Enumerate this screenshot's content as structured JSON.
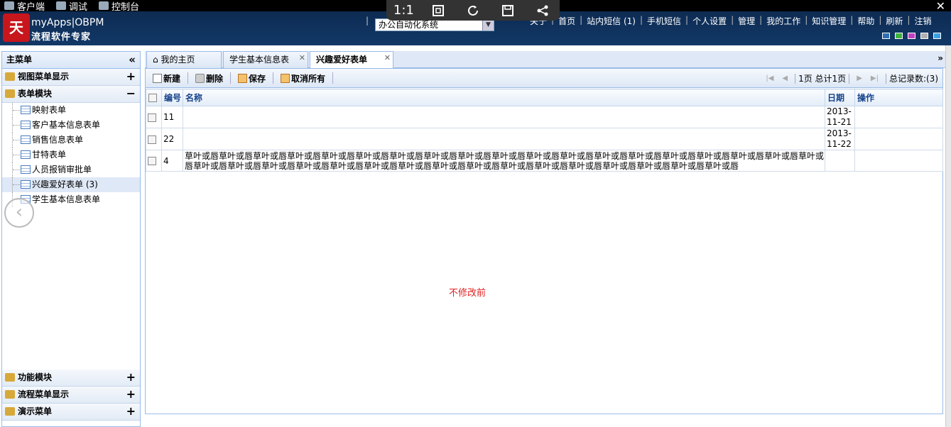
{
  "topbar": {
    "items": [
      {
        "label": "客户端",
        "icon": "gear-icon"
      },
      {
        "label": "调试",
        "icon": "gear-icon"
      },
      {
        "label": "控制台",
        "icon": "console-icon"
      }
    ],
    "close": "✕"
  },
  "viewer": {
    "zoom_label": "1:1",
    "buttons": [
      "fit-icon",
      "rotate-icon",
      "save-icon",
      "share-icon"
    ]
  },
  "header": {
    "logo_text": "天翎",
    "brand_line1": "myApps|OBPM",
    "brand_line2": "流程软件专家",
    "system_select": "办公自动化系统",
    "nav": [
      "关于",
      "首页",
      "站内短信 (1)",
      "手机短信",
      "个人设置",
      "管理",
      "我的工作",
      "知识管理",
      "帮助",
      "刷新",
      "注销"
    ],
    "swatch_colors": [
      "#2f6fb0",
      "#3cb43c",
      "#c040c0",
      "#b0b0b0",
      "#3aa0e0"
    ]
  },
  "sidebar": {
    "title": "主菜单",
    "collapse_icon": "«",
    "groups_top": [
      {
        "label": "视图菜单显示",
        "toggle": "+"
      },
      {
        "label": "表单模块",
        "toggle": "−"
      }
    ],
    "items": [
      {
        "label": "映射表单"
      },
      {
        "label": "客户基本信息表单"
      },
      {
        "label": "销售信息表单"
      },
      {
        "label": "甘特表单"
      },
      {
        "label": "人员报销审批单"
      },
      {
        "label": "兴趣爱好表单 (3)"
      },
      {
        "label": "学生基本信息表单"
      }
    ],
    "groups_bottom": [
      {
        "label": "功能模块",
        "toggle": "+"
      },
      {
        "label": "流程菜单显示",
        "toggle": "+"
      },
      {
        "label": "演示菜单",
        "toggle": "+"
      }
    ]
  },
  "tabs": [
    {
      "label": "我的主页",
      "icon": "home-icon"
    },
    {
      "label": "学生基本信息表",
      "closable": true
    },
    {
      "label": "兴趣爱好表单",
      "closable": true,
      "active": true
    }
  ],
  "tab_scroll_icon": "»",
  "toolbar": {
    "new": "新建",
    "delete": "删除",
    "save": "保存",
    "cancel_all": "取消所有"
  },
  "pager": {
    "page_info": "1页 总计1页",
    "total": "总记录数:(3)"
  },
  "grid": {
    "headers": {
      "id": "编号",
      "name": "名称",
      "date": "日期",
      "action": "操作"
    },
    "rows": [
      {
        "id": "11",
        "name": "",
        "date": "2013-11-21"
      },
      {
        "id": "22",
        "name": "",
        "date": "2013-11-22"
      },
      {
        "id": "4",
        "name": "草叶或唇草叶或唇草叶或唇草叶或唇草叶或唇草叶或唇草叶或唇草叶或唇草叶或唇草叶或唇草叶或唇草叶或唇草叶或唇草叶或唇草叶或唇草叶或唇草叶或唇草叶或唇草叶或唇草叶或唇草叶或唇草叶或唇草叶或唇草叶或唇草叶或唇草叶或唇草叶或唇草叶或唇草叶或唇草叶或唇草叶或唇草叶或唇草叶或唇草叶或唇草叶或唇",
        "date": ""
      }
    ]
  },
  "notice": "不修改前"
}
